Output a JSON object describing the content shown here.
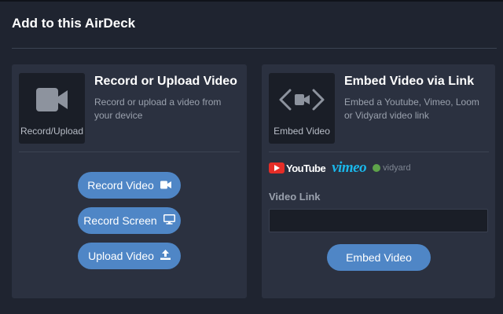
{
  "dialog": {
    "title": "Add to this AirDeck"
  },
  "record_card": {
    "tile_label": "Record/Upload",
    "title": "Record or Upload Video",
    "description": "Record or upload a video from your device",
    "buttons": {
      "record_video": "Record Video",
      "record_screen": "Record Screen",
      "upload_video": "Upload Video"
    }
  },
  "embed_card": {
    "tile_label": "Embed Video",
    "title": "Embed Video via Link",
    "description": "Embed a Youtube, Vimeo, Loom or Vidyard video link",
    "brands": {
      "youtube": "YouTube",
      "vimeo": "vimeo",
      "vidyard": "vidyard"
    },
    "field_label": "Video Link",
    "field_value": "",
    "field_placeholder": "",
    "button_label": "Embed Video"
  },
  "colors": {
    "background": "#1f2430",
    "card": "#2b3140",
    "tile": "#1a1e27",
    "accent_button": "#4f86c6",
    "youtube_red": "#e52d27",
    "vimeo_blue": "#1ab7ea",
    "vidyard_green": "#5ea34a"
  },
  "icons": {
    "record_tile": "video-camera-icon",
    "embed_tile": "embed-code-video-icon",
    "record_video": "video-camera-icon",
    "record_screen": "monitor-icon",
    "upload_video": "upload-icon"
  }
}
